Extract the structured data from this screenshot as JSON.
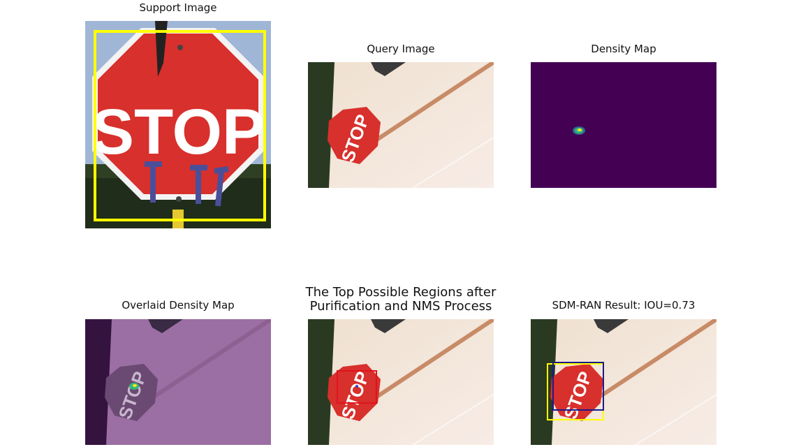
{
  "figure": {
    "panels": [
      {
        "id": "support",
        "title": "Support Image",
        "sign_text": "STOP"
      },
      {
        "id": "query",
        "title": "Query Image",
        "sign_text": "STOP"
      },
      {
        "id": "density",
        "title": "Density Map"
      },
      {
        "id": "overlay",
        "title": "Overlaid Density Map",
        "sign_text": "STOP"
      },
      {
        "id": "regions",
        "title": "The Top Possible Regions after Purification and NMS Process",
        "sign_text": "STOP"
      },
      {
        "id": "result",
        "title": "SDM-RAN Result: IOU=0.73",
        "sign_text": "STOP"
      }
    ]
  },
  "colors": {
    "sign_red": "#d8302c",
    "density_bg": "#440154",
    "support_box": "#ffff00",
    "region_box": "#e0141e",
    "gt_box": "#ffff00",
    "pred_box": "#1a1a8c",
    "overlay_tint": "#9b6fa3"
  }
}
